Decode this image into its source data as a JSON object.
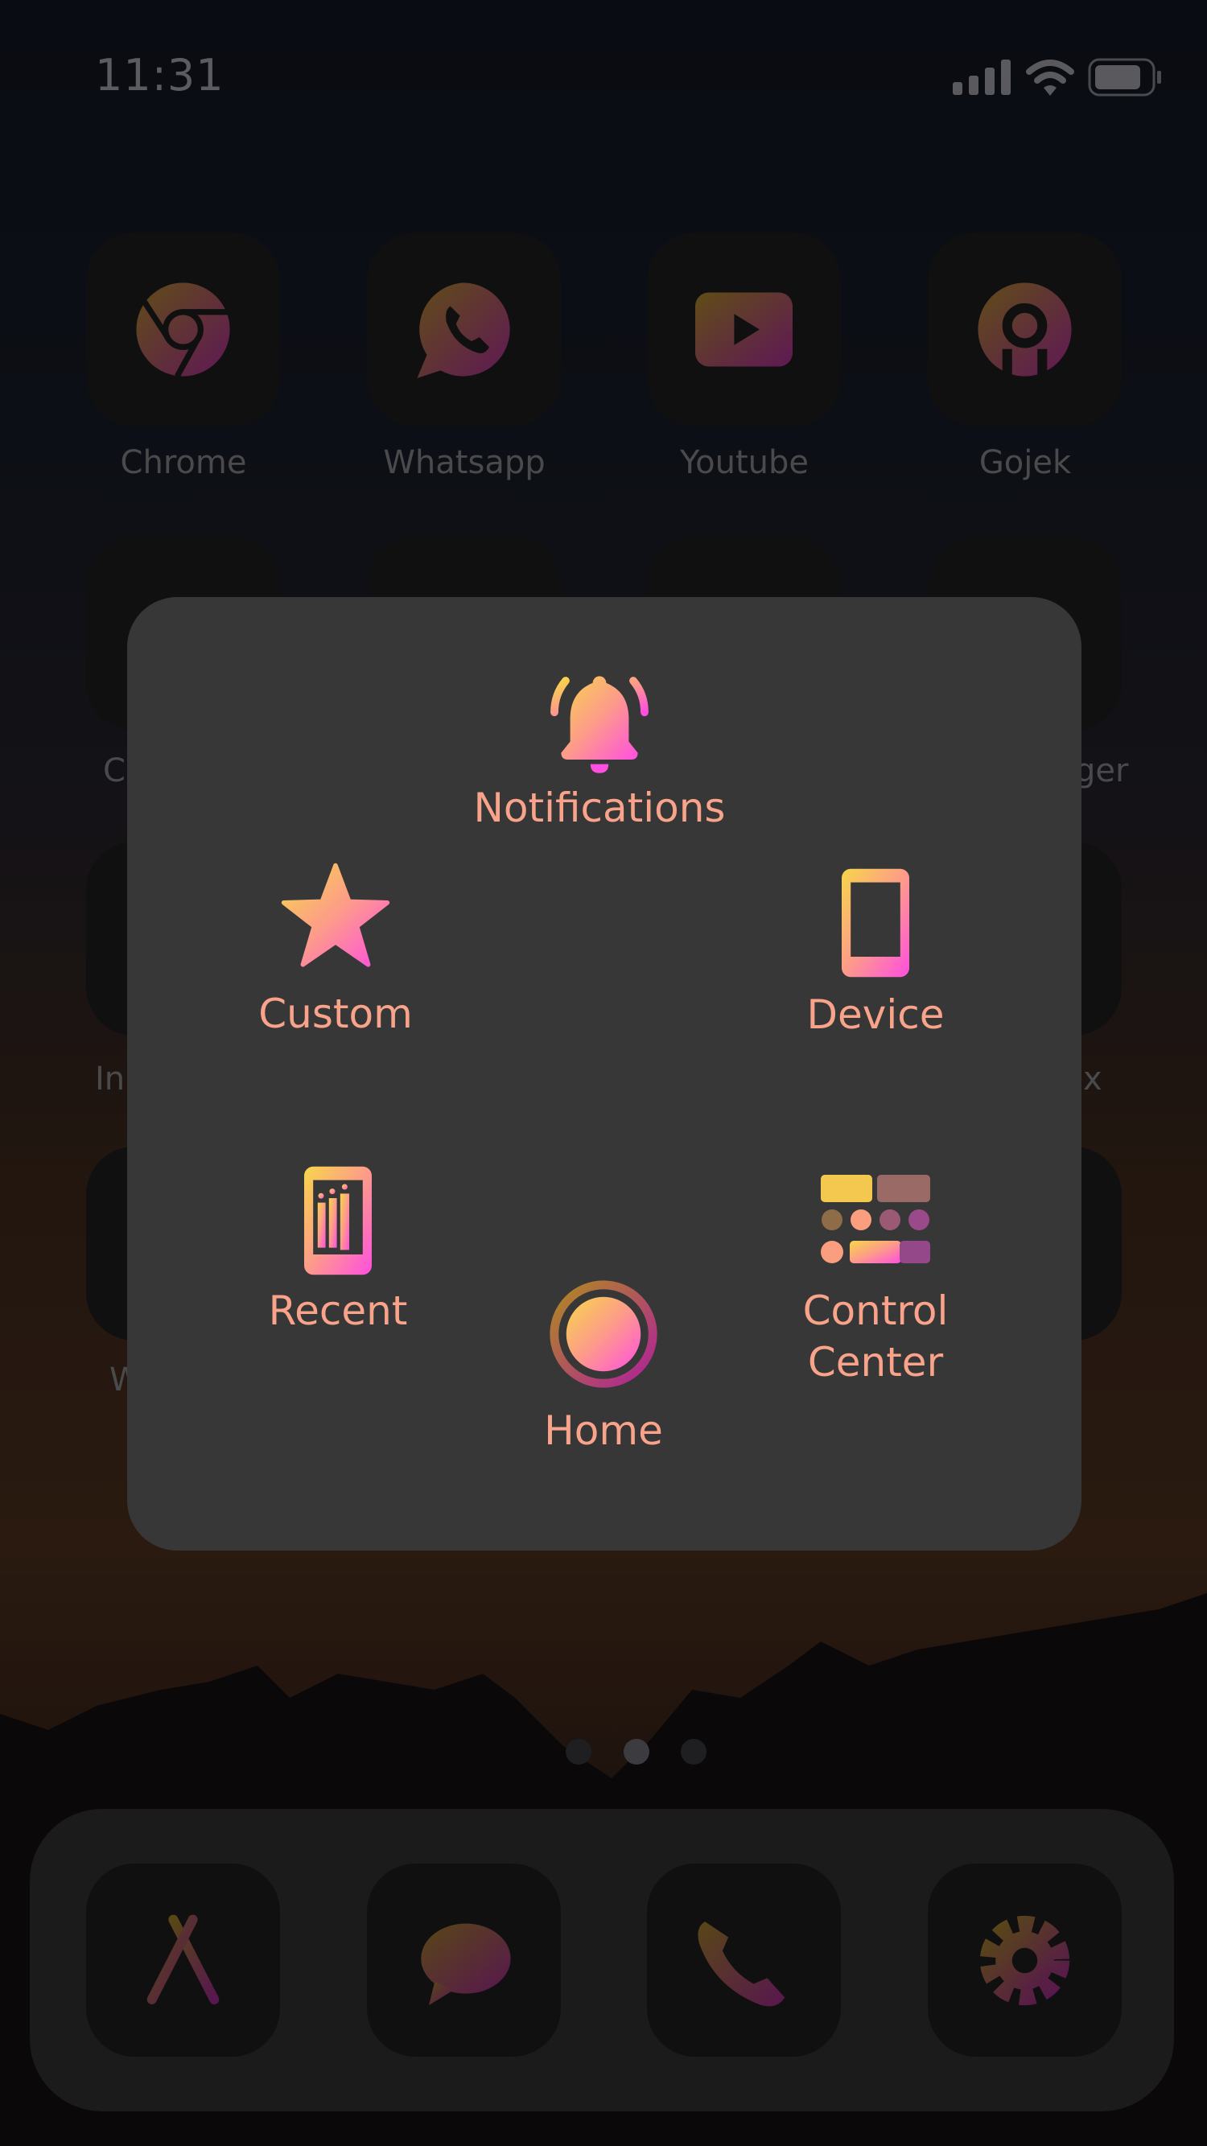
{
  "status_bar": {
    "time": "11:31",
    "icons": [
      "cellular-signal-icon",
      "wifi-icon",
      "battery-icon"
    ]
  },
  "home_screen": {
    "row1": [
      {
        "label": "Chrome",
        "icon": "chrome-icon"
      },
      {
        "label": "Whatsapp",
        "icon": "whatsapp-icon"
      },
      {
        "label": "Youtube",
        "icon": "youtube-icon"
      },
      {
        "label": "Gojek",
        "icon": "gojek-icon"
      }
    ],
    "partial_labels": {
      "row2_left": "C",
      "row2_right": "ger",
      "row3_left": "In",
      "row3_right": "x",
      "row4_left": "W"
    },
    "page_indicator": {
      "pages": 3,
      "current": 2
    },
    "dock": [
      {
        "icon": "app-store-icon"
      },
      {
        "icon": "messages-icon"
      },
      {
        "icon": "phone-icon"
      },
      {
        "icon": "settings-gear-icon"
      }
    ]
  },
  "assistive_touch_menu": {
    "items": [
      {
        "label": "Notifications",
        "icon": "bell-icon"
      },
      {
        "label": "Custom",
        "icon": "star-icon"
      },
      {
        "label": "Device",
        "icon": "device-phone-icon"
      },
      {
        "label": "Recent",
        "icon": "recent-apps-icon"
      },
      {
        "label": "Home",
        "icon": "home-button-icon"
      },
      {
        "label": "Control Center",
        "label_line1": "Control",
        "label_line2": "Center",
        "icon": "control-center-icon"
      }
    ]
  },
  "colors": {
    "panel": "#373737",
    "label": "#f9a48a",
    "gradient_start": "#f7d64a",
    "gradient_end": "#ff4fe0"
  }
}
